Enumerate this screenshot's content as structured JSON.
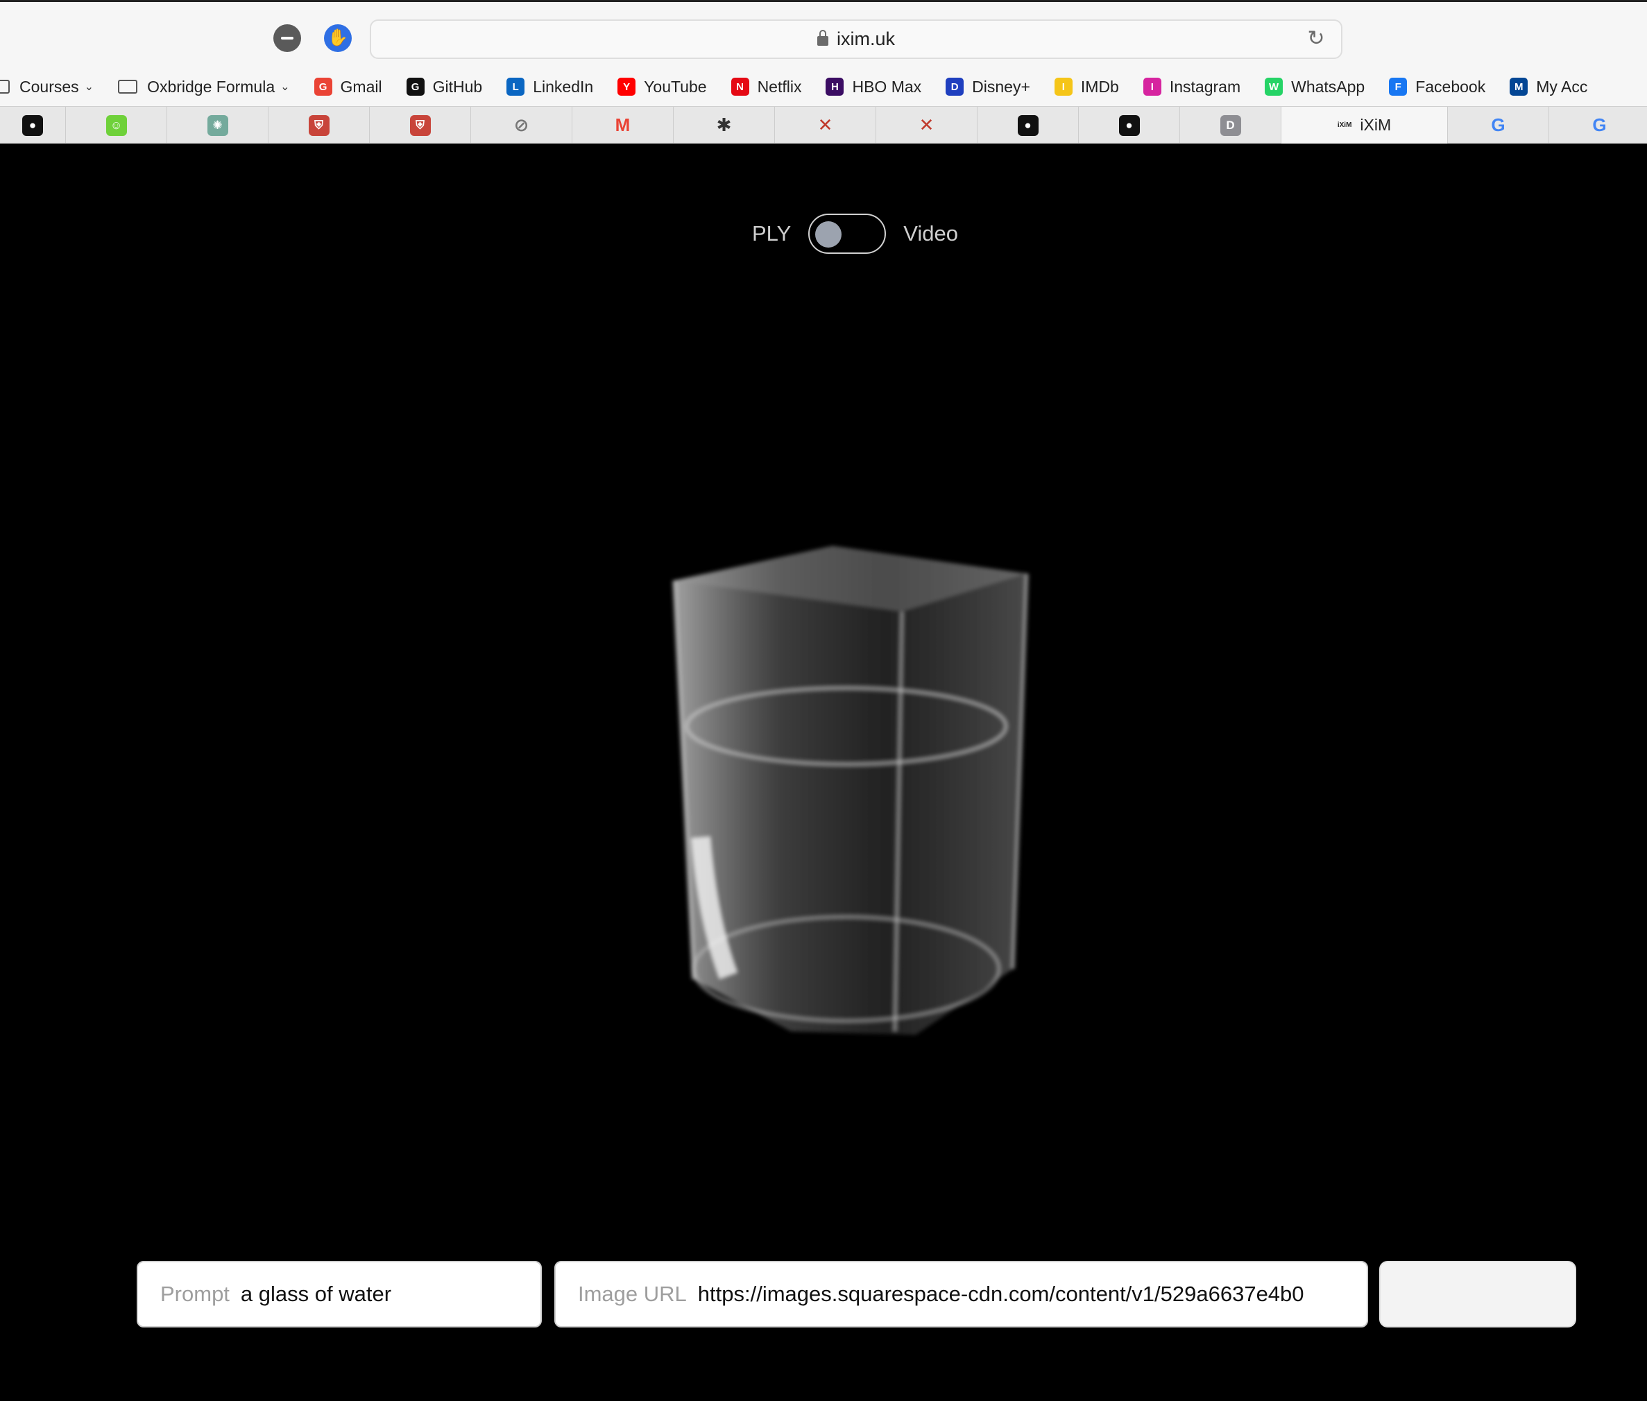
{
  "browser": {
    "url": "ixim.uk"
  },
  "bookmarks": [
    {
      "label": "Courses",
      "icon": "folder-icon",
      "dropdown": true
    },
    {
      "label": "Oxbridge Formula",
      "icon": "folder-icon",
      "dropdown": true
    },
    {
      "label": "Gmail",
      "icon": "gmail-icon",
      "color": "#ea4335"
    },
    {
      "label": "GitHub",
      "icon": "github-icon",
      "color": "#111111"
    },
    {
      "label": "LinkedIn",
      "icon": "linkedin-icon",
      "color": "#0a66c2"
    },
    {
      "label": "YouTube",
      "icon": "youtube-icon",
      "color": "#ff0000"
    },
    {
      "label": "Netflix",
      "icon": "netflix-icon",
      "color": "#e50914"
    },
    {
      "label": "HBO Max",
      "icon": "hbomax-icon",
      "color": "#3b0d63"
    },
    {
      "label": "Disney+",
      "icon": "disney-icon",
      "color": "#1f3fbf"
    },
    {
      "label": "IMDb",
      "icon": "imdb-icon",
      "color": "#f5c518"
    },
    {
      "label": "Instagram",
      "icon": "instagram-icon",
      "color": "#d6249f"
    },
    {
      "label": "WhatsApp",
      "icon": "whatsapp-icon",
      "color": "#25d366"
    },
    {
      "label": "Facebook",
      "icon": "facebook-icon",
      "color": "#1877f2"
    },
    {
      "label": "My Acc",
      "icon": "chelsea-icon",
      "color": "#034694"
    }
  ],
  "tabs": [
    {
      "icon": "github-icon",
      "glyph": "●",
      "color": "#111111"
    },
    {
      "icon": "smiley-icon",
      "glyph": "☺",
      "color": "#6fd13a"
    },
    {
      "icon": "chatgpt-icon",
      "glyph": "✺",
      "color": "#74aa9c"
    },
    {
      "icon": "cambridge-crest-icon",
      "glyph": "⛨",
      "color": "#c8443a"
    },
    {
      "icon": "cambridge-crest-icon",
      "glyph": "⛨",
      "color": "#c8443a"
    },
    {
      "icon": "compass-icon",
      "glyph": "⊘",
      "color": "#777777"
    },
    {
      "icon": "gmail-icon",
      "glyph": "M",
      "color": "#ea4335"
    },
    {
      "icon": "bug-icon",
      "glyph": "✱",
      "color": "#333333"
    },
    {
      "icon": "x-mark-icon",
      "glyph": "✕",
      "color": "#c0392b"
    },
    {
      "icon": "x-mark-icon",
      "glyph": "✕",
      "color": "#c0392b"
    },
    {
      "icon": "github-icon",
      "glyph": "●",
      "color": "#111111"
    },
    {
      "icon": "github-icon",
      "glyph": "●",
      "color": "#111111"
    },
    {
      "icon": "d-icon",
      "glyph": "D",
      "color": "#8e8e93"
    },
    {
      "icon": "ixim-icon",
      "glyph": "iXiM",
      "color": "#222222",
      "label": "iXiM",
      "active": true
    },
    {
      "icon": "google-icon",
      "glyph": "G",
      "color": "#4285f4"
    },
    {
      "icon": "google-icon",
      "glyph": "G",
      "color": "#4285f4"
    }
  ],
  "toggle": {
    "left_label": "PLY",
    "right_label": "Video",
    "state": "off"
  },
  "form": {
    "prompt_label": "Prompt",
    "prompt_value": "a glass of water",
    "image_url_label": "Image URL",
    "image_url_value": "https://images.squarespace-cdn.com/content/v1/529a6637e4b0"
  }
}
